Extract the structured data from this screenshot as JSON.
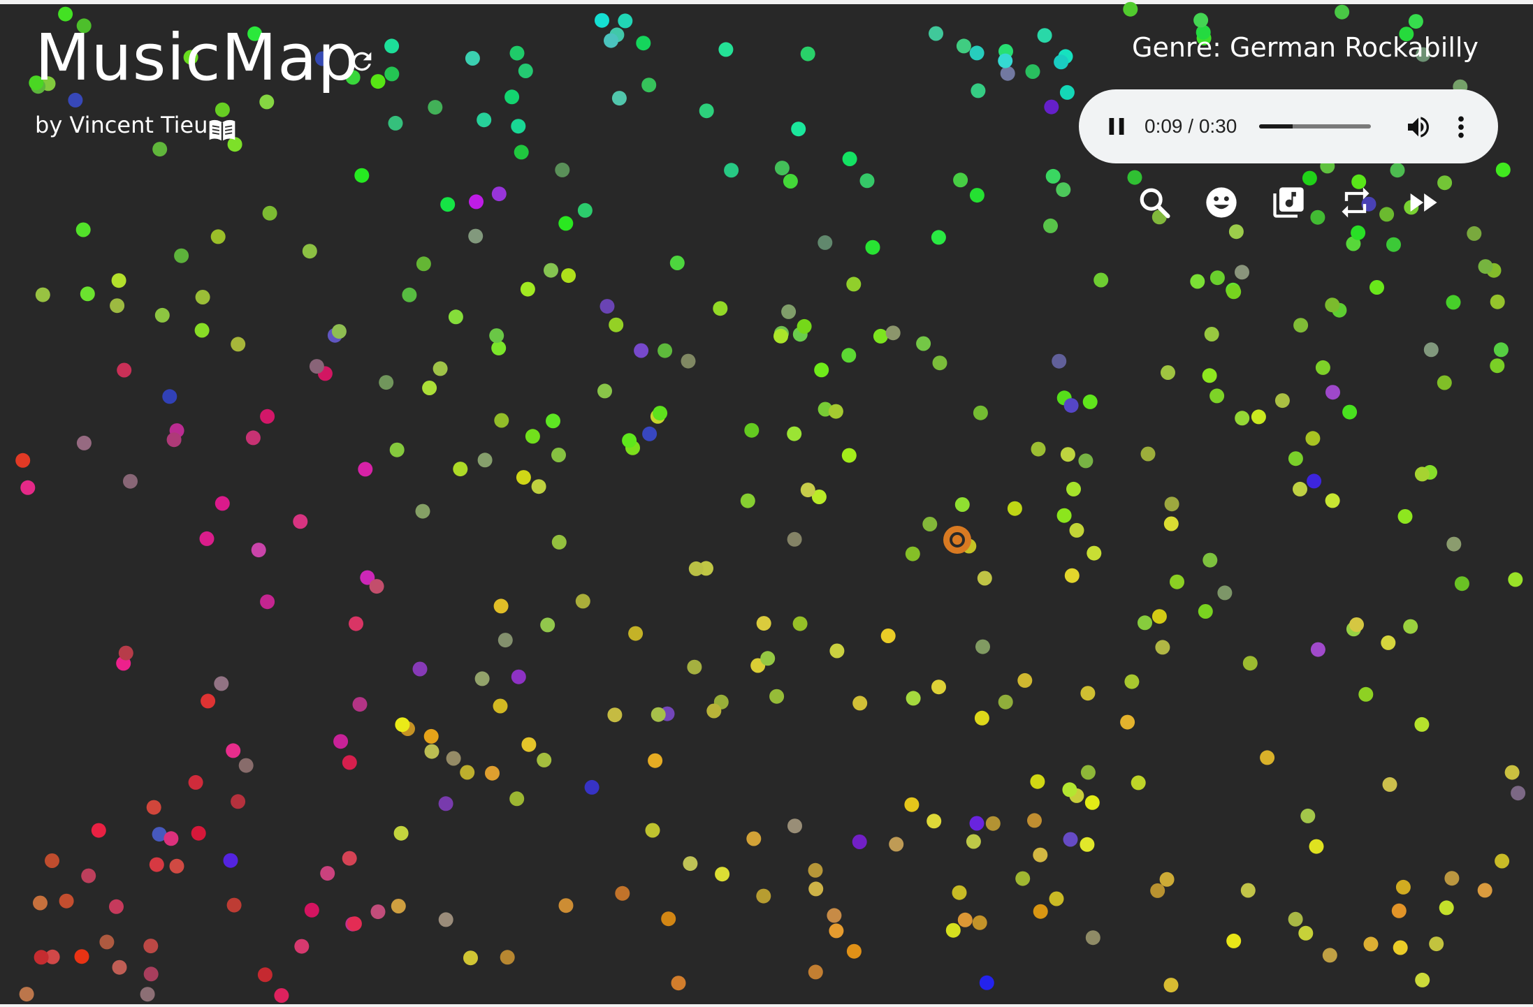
{
  "app": {
    "title": "MusicMap",
    "byline": "by Vincent Tieu",
    "genre_label": "Genre: German Rockabilly"
  },
  "player": {
    "time": "0:09 / 0:30",
    "progress_fraction": 0.3
  },
  "controls": [
    {
      "name": "search-button",
      "icon": "search-icon"
    },
    {
      "name": "mood-button",
      "icon": "smiley-icon"
    },
    {
      "name": "playlist-button",
      "icon": "music-library-icon"
    },
    {
      "name": "repeat-button",
      "icon": "repeat-icon"
    },
    {
      "name": "fast-forward-button",
      "icon": "fast-forward-icon"
    }
  ],
  "colors": {
    "background": "#282828",
    "player_bg": "#f1f3f4",
    "selected_genre": "#d97a22"
  }
}
